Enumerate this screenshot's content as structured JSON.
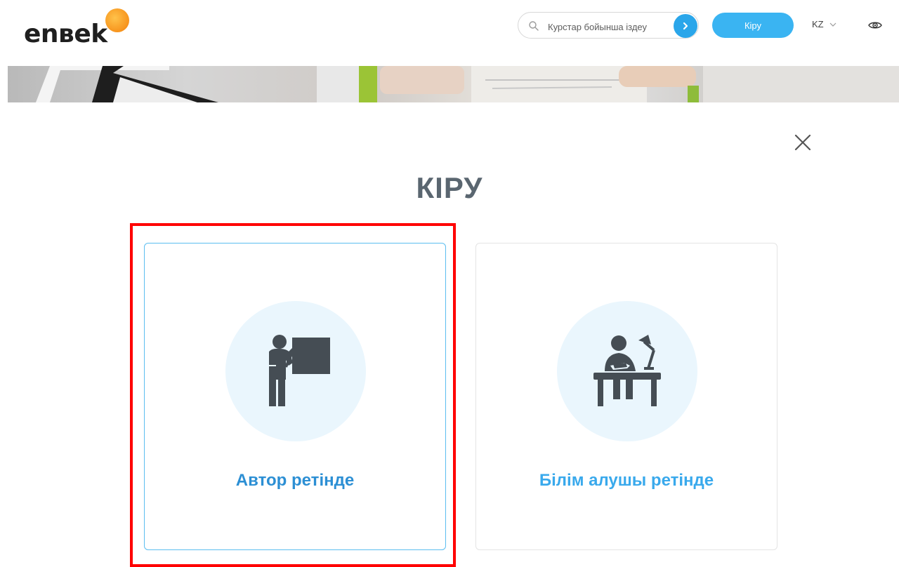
{
  "header": {
    "logo_text": "enвek",
    "search": {
      "placeholder": "Курстар бойынша іздеу"
    },
    "login_label": "Кіру",
    "language": "KZ",
    "icons": {
      "search": "search-icon",
      "go": "chevron-right-icon",
      "lang": "chevron-down-icon",
      "accessibility": "eye-icon"
    },
    "colors": {
      "accent": "#3ab4f2",
      "logo_dot": "#f7941d"
    }
  },
  "modal": {
    "title": "КІРУ",
    "close_icon": "close-icon",
    "options": [
      {
        "label": "Автор ретінде",
        "icon": "teacher-blackboard-icon"
      },
      {
        "label": "Білім алушы ретінде",
        "icon": "student-desk-icon"
      }
    ],
    "colors": {
      "selected_border": "#5bbdf0",
      "highlight": "#ff0000"
    }
  }
}
